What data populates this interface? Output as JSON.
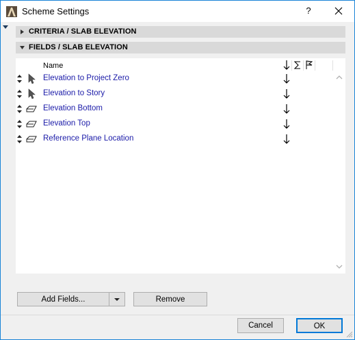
{
  "window": {
    "title": "Scheme Settings",
    "help_label": "?",
    "close_icon": "close-icon",
    "accent_color": "#1883d7"
  },
  "sections": {
    "criteria": {
      "label": "CRITERIA /  SLAB ELEVATION",
      "expanded": false
    },
    "fields": {
      "label": "FIELDS /  SLAB ELEVATION",
      "expanded": true
    }
  },
  "list": {
    "header": {
      "name": "Name",
      "columns": [
        "sort-order-icon",
        "sum-icon",
        "flag-icon"
      ]
    },
    "rows": [
      {
        "name": "Elevation to Project Zero",
        "icon": "arrow-pointer-icon",
        "sort": "down-arrow-icon"
      },
      {
        "name": "Elevation to Story",
        "icon": "arrow-pointer-icon",
        "sort": "down-arrow-icon"
      },
      {
        "name": "Elevation Bottom",
        "icon": "slab-tag-icon",
        "sort": "down-arrow-icon"
      },
      {
        "name": "Elevation Top",
        "icon": "slab-tag-icon",
        "sort": "down-arrow-icon"
      },
      {
        "name": "Reference Plane Location",
        "icon": "slab-tag-icon",
        "sort": "down-arrow-icon"
      }
    ],
    "text_color": "#1a1aa8"
  },
  "buttons": {
    "add_fields": "Add Fields...",
    "remove": "Remove",
    "cancel": "Cancel",
    "ok": "OK"
  }
}
